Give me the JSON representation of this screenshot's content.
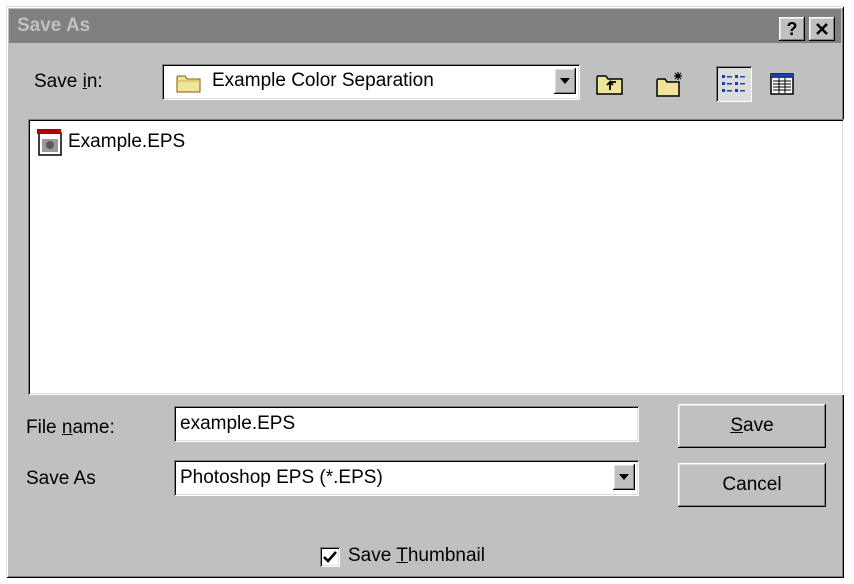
{
  "dialog": {
    "title": "Save As",
    "help_button": "?",
    "close_button": "✕"
  },
  "save_in": {
    "label_prefix": "Save ",
    "label_access": "i",
    "label_suffix": "n:",
    "folder": "Example Color Separation"
  },
  "toolbar": {
    "up_one_level": "up-folder-icon",
    "create_new_folder": "new-folder-icon",
    "list_view": "list-view-icon",
    "details_view": "details-view-icon"
  },
  "files": [
    {
      "name": "Example.EPS",
      "icon": "eps-file-icon"
    }
  ],
  "file_name": {
    "label_prefix": "File ",
    "label_access": "n",
    "label_suffix": "ame:",
    "value": "example.EPS"
  },
  "save_as_type": {
    "label": "Save As",
    "value": "Photoshop EPS (*.EPS)"
  },
  "buttons": {
    "save_access": "S",
    "save_rest": "ave",
    "cancel": "Cancel"
  },
  "thumbnail": {
    "checked": true,
    "label_prefix": "Save ",
    "label_access": "T",
    "label_suffix": "humbnail"
  },
  "colors": {
    "dialog_face": "#c0c0c0",
    "titlebar_inactive": "#808080",
    "title_text_inactive": "#c0c0c0",
    "window": "#ffffff"
  }
}
